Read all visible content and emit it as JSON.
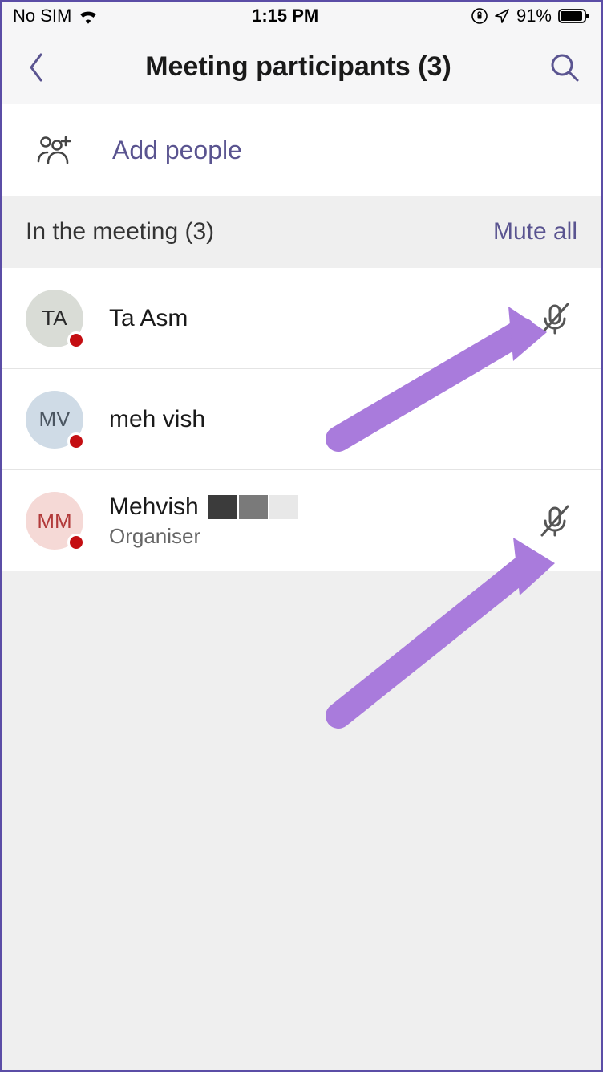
{
  "status_bar": {
    "carrier": "No SIM",
    "time": "1:15 PM",
    "battery_pct": "91%"
  },
  "header": {
    "title": "Meeting participants (3)"
  },
  "add_people": {
    "label": "Add people"
  },
  "section": {
    "title": "In the meeting (3)",
    "mute_all": "Mute all"
  },
  "participants": [
    {
      "initials": "TA",
      "name": "Ta Asm",
      "role": "",
      "avatar_bg": "#d9dcd6",
      "avatar_fg": "#2b2b2b",
      "show_mic": true,
      "redacted": false
    },
    {
      "initials": "MV",
      "name": "meh vish",
      "role": "",
      "avatar_bg": "#cfdbe6",
      "avatar_fg": "#4a5560",
      "show_mic": false,
      "redacted": false
    },
    {
      "initials": "MM",
      "name": "Mehvish",
      "role": "Organiser",
      "avatar_bg": "#f5d9d6",
      "avatar_fg": "#b23a3a",
      "show_mic": true,
      "redacted": true
    }
  ]
}
